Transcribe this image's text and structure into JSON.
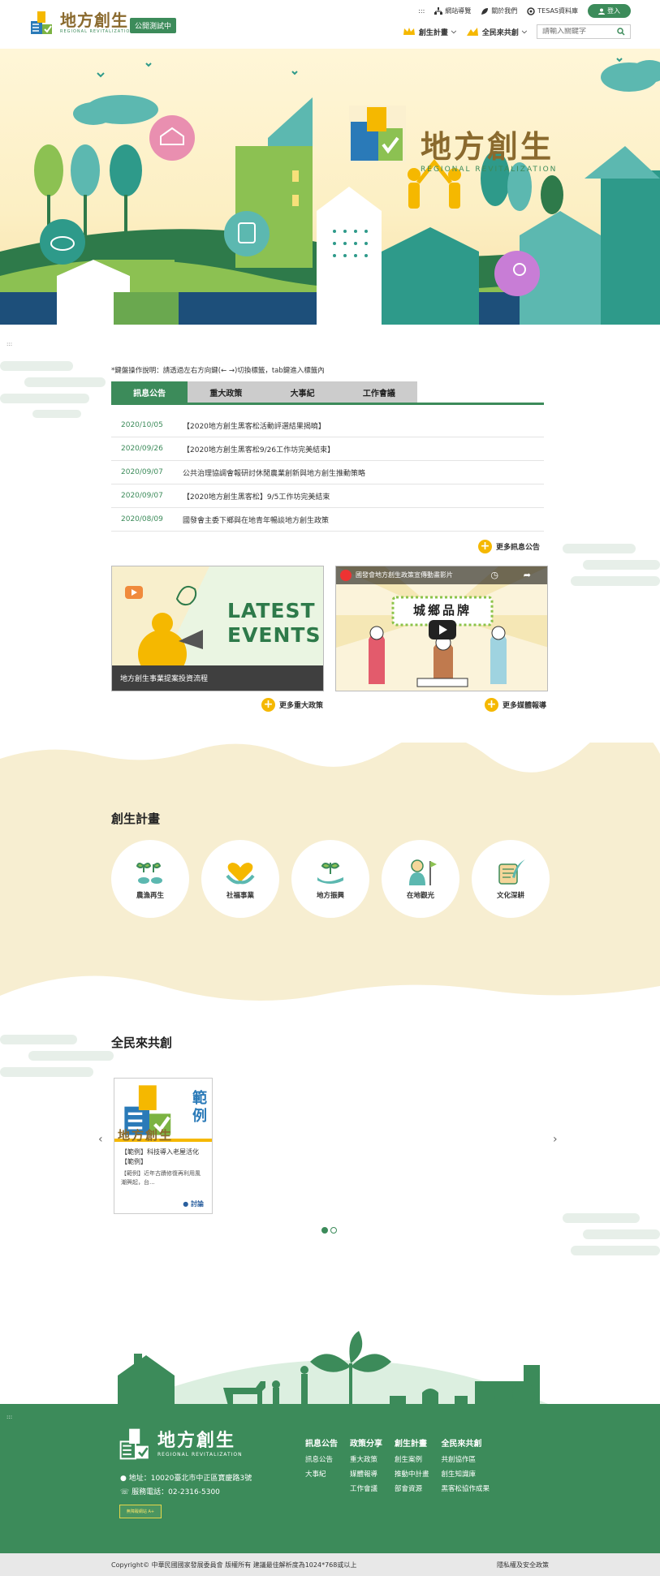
{
  "header": {
    "logo_cn": "地方創生",
    "logo_en": "REGIONAL REVITALIZATION",
    "badge": "公開測試中",
    "anchor": ":::",
    "links": [
      {
        "label": "網站導覽",
        "icon": "sitemap-icon"
      },
      {
        "label": "關於我們",
        "icon": "leaf-icon"
      },
      {
        "label": "TESAS資料庫",
        "icon": "database-icon"
      }
    ],
    "login": "登入",
    "nav": [
      {
        "label": "創生計畫",
        "icon": "crown-icon"
      },
      {
        "label": "全民來共創",
        "icon": "hands-icon"
      }
    ],
    "search_placeholder": "請輸入關鍵字"
  },
  "hero": {
    "logo_cn": "地方創生",
    "logo_en": "REGIONAL REVITALIZATION"
  },
  "content_anchor": ":::",
  "news": {
    "hint": "*鍵盤操作說明：請透過左右方向鍵(← →)切換標籤，tab鍵進入標籤內",
    "tabs": [
      "訊息公告",
      "重大政策",
      "大事紀",
      "工作會議"
    ],
    "active_tab": 0,
    "items": [
      {
        "date": "2020/10/05",
        "title": "【2020地方創生黑客松活動評選結果揭曉】"
      },
      {
        "date": "2020/09/26",
        "title": "【2020地方創生黑客松9/26工作坊完美結束】"
      },
      {
        "date": "2020/09/07",
        "title": "公共治理協調會報研討休閒農業創新與地方創生推動策略"
      },
      {
        "date": "2020/09/07",
        "title": "【2020地方創生黑客松】9/5工作坊完美結束"
      },
      {
        "date": "2020/08/09",
        "title": "國發會主委下鄉與在地青年暢談地方創生政策"
      }
    ],
    "more": "更多訊息公告"
  },
  "cards": {
    "card1_line1": "LATEST",
    "card1_line2": "EVENTS",
    "card1_caption": "地方創生事業提案投資流程",
    "card1_more": "更多重大政策",
    "video_title": "國發會地方創生政策宣傳動畫影片",
    "video_banner": "城鄉品牌",
    "card2_more": "更多媒體報導"
  },
  "plans": {
    "title": "創生計畫",
    "items": [
      {
        "label": "農漁再生",
        "icon": "sprout-fish-icon"
      },
      {
        "label": "社福事業",
        "icon": "heart-hands-icon"
      },
      {
        "label": "地方振興",
        "icon": "hand-sprout-icon"
      },
      {
        "label": "在地觀光",
        "icon": "guide-flag-icon"
      },
      {
        "label": "文化深耕",
        "icon": "scroll-quill-icon"
      }
    ]
  },
  "cocreate": {
    "title": "全民來共創",
    "card_badge": "範例",
    "card_logo": "地方創生",
    "card_title": "【範例】科技導入老屋活化【範例】",
    "card_desc": "【範例】近年古蹟修復再利用風潮興起，台...",
    "card_tag": "討論",
    "slides": 2,
    "active_slide": 0
  },
  "footer": {
    "anchor": ":::",
    "logo_cn": "地方創生",
    "logo_en": "REGIONAL REVITALIZATION",
    "address": "地址：10020臺北市中正區寶慶路3號",
    "phone": "服務電話：02-2316-5300",
    "accessibility": "無障礙網站 A+",
    "columns": [
      {
        "heading": "訊息公告",
        "links": [
          "訊息公告",
          "大事紀"
        ]
      },
      {
        "heading": "政策分享",
        "links": [
          "重大政策",
          "媒體報導",
          "工作會議"
        ]
      },
      {
        "heading": "創生計畫",
        "links": [
          "創生案例",
          "推動中計畫",
          "部會資源"
        ]
      },
      {
        "heading": "全民來共創",
        "links": [
          "共創協作區",
          "創生知識庫",
          "黑客松協作成果"
        ]
      }
    ],
    "copyright": "Copyright© 中華民國國家發展委員會 版權所有 建議最佳解析度為1024*768或以上",
    "privacy": "隱私權及安全政策"
  },
  "colors": {
    "brand_green": "#3c8b5a",
    "accent_yellow": "#f5b800",
    "sand": "#f7eed1"
  }
}
